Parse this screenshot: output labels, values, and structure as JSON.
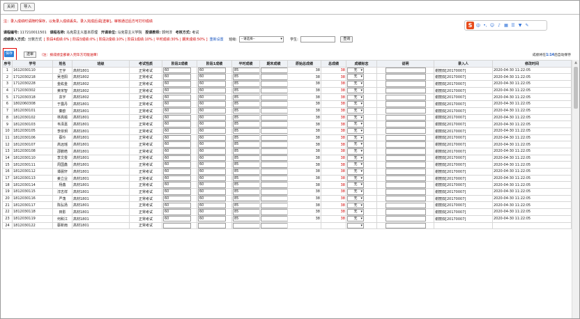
{
  "toolbar": {
    "close_label": "关闭",
    "import_label": "导入"
  },
  "notice": "注：录入成绩时请随时保存，以免录入成绩丢失。录入完成后请[送审]，审核通过后方可打印成绩",
  "course_info": {
    "code_label": "课程编号:",
    "code": "117210011501",
    "name_label": "课程名称:",
    "name": "马克思主义基本原理",
    "dept_label": "开课单位:",
    "dept": "马克思主义学院",
    "teacher_label": "授课教师:",
    "teacher": "郭何淳",
    "exam_label": "考核方式:",
    "exam": "考试"
  },
  "method": {
    "label": "成绩录入方式:",
    "mode": "分数方式",
    "weights": "[ 阶段4成绩:0% | 阶段3成绩:0% | 阶段2成绩:10% | 阶段1成绩:10% | 平时成绩:30% | 期末成绩:50% ]",
    "reset": "重新设置",
    "class_label": "班级:",
    "class_select": "--请选择--",
    "student_label": "学生:",
    "query_label": "查询"
  },
  "actions": {
    "save_label": "保存",
    "back_label": "送审",
    "hint": "（注：按成绩全部录入完毕方可能送审）",
    "autosave_pre": "成绩将在",
    "autosave_time": "1:14",
    "autosave_post": "后自动保存"
  },
  "table": {
    "headers": [
      "序号",
      "学号",
      "姓名",
      "班级",
      "考试性质",
      "阶段2成绩",
      "阶段1成绩",
      "平时成绩",
      "期末成绩",
      "原始总成绩",
      "总成绩",
      "成绩标志",
      "说明",
      "录入人",
      "修改时间"
    ],
    "rows": [
      {
        "no": "1",
        "id": "1612030110",
        "name": "王宇",
        "cls": "高材1801",
        "nature": "正常考试",
        "s2": "60",
        "s1": "60",
        "p": "85",
        "f": "",
        "raw": "38",
        "total": "38",
        "flag": "无",
        "recorder": "谢丽双[20170007]",
        "time": "2020-04-30 11:22:05"
      },
      {
        "no": "2",
        "id": "1712030218",
        "name": "吴浩阳",
        "cls": "高材1802",
        "nature": "正常考试",
        "s2": "60",
        "s1": "60",
        "p": "85",
        "f": "",
        "raw": "38",
        "total": "38",
        "flag": "无",
        "recorder": "谢丽双[20170007]",
        "time": "2020-04-30 11:22:05"
      },
      {
        "no": "3",
        "id": "1712030228",
        "name": "金紘金",
        "cls": "高材1802",
        "nature": "正常考试",
        "s2": "60",
        "s1": "60",
        "p": "85",
        "f": "",
        "raw": "38",
        "total": "38",
        "flag": "无",
        "recorder": "谢丽双[20170007]",
        "time": "2020-04-30 11:22:05"
      },
      {
        "no": "4",
        "id": "1712030302",
        "name": "黄宋智",
        "cls": "高材1802",
        "nature": "正常考试",
        "s2": "60",
        "s1": "60",
        "p": "85",
        "f": "",
        "raw": "38",
        "total": "38",
        "flag": "无",
        "recorder": "谢丽双[20170007]",
        "time": "2020-04-30 11:22:05"
      },
      {
        "no": "5",
        "id": "1712030318",
        "name": "袁宇",
        "cls": "高材1802",
        "nature": "正常考试",
        "s2": "60",
        "s1": "60",
        "p": "85",
        "f": "",
        "raw": "38",
        "total": "38",
        "flag": "无",
        "recorder": "谢丽双[20170007]",
        "time": "2020-04-30 11:22:05"
      },
      {
        "no": "6",
        "id": "1802060308",
        "name": "于露丹",
        "cls": "高材1801",
        "nature": "正常考试",
        "s2": "60",
        "s1": "60",
        "p": "85",
        "f": "",
        "raw": "38",
        "total": "38",
        "flag": "无",
        "recorder": "谢丽双[20170007]",
        "time": "2020-04-30 11:22:05"
      },
      {
        "no": "7",
        "id": "1812030101",
        "name": "秦欧",
        "cls": "高材1801",
        "nature": "正常考试",
        "s2": "60",
        "s1": "60",
        "p": "85",
        "f": "",
        "raw": "38",
        "total": "38",
        "flag": "无",
        "recorder": "谢丽双[20170007]",
        "time": "2020-04-30 11:22:05"
      },
      {
        "no": "8",
        "id": "1812030102",
        "name": "林高喻",
        "cls": "高材1801",
        "nature": "正常考试",
        "s2": "60",
        "s1": "60",
        "p": "85",
        "f": "",
        "raw": "38",
        "total": "38",
        "flag": "无",
        "recorder": "谢丽双[20170007]",
        "time": "2020-04-30 11:22:05"
      },
      {
        "no": "9",
        "id": "1812030103",
        "name": "韦泽嘉",
        "cls": "高材1801",
        "nature": "正常考试",
        "s2": "60",
        "s1": "60",
        "p": "85",
        "f": "",
        "raw": "38",
        "total": "38",
        "flag": "无",
        "recorder": "谢丽双[20170007]",
        "time": "2020-04-30 11:22:05"
      },
      {
        "no": "10",
        "id": "1812030105",
        "name": "李依玥",
        "cls": "高材1801",
        "nature": "正常考试",
        "s2": "60",
        "s1": "60",
        "p": "85",
        "f": "",
        "raw": "38",
        "total": "38",
        "flag": "无",
        "recorder": "谢丽双[20170007]",
        "time": "2020-04-30 11:22:05"
      },
      {
        "no": "11",
        "id": "1812030106",
        "name": "蔡玲",
        "cls": "高材1801",
        "nature": "正常考试",
        "s2": "60",
        "s1": "60",
        "p": "85",
        "f": "",
        "raw": "38",
        "total": "38",
        "flag": "无",
        "recorder": "谢丽双[20170007]",
        "time": "2020-04-30 11:22:05"
      },
      {
        "no": "12",
        "id": "1812030107",
        "name": "高远瑶",
        "cls": "高材1801",
        "nature": "正常考试",
        "s2": "60",
        "s1": "60",
        "p": "85",
        "f": "",
        "raw": "38",
        "total": "38",
        "flag": "无",
        "recorder": "谢丽双[20170007]",
        "time": "2020-04-30 11:22:05"
      },
      {
        "no": "13",
        "id": "1812030108",
        "name": "邵鹏皓",
        "cls": "高材1801",
        "nature": "正常考试",
        "s2": "60",
        "s1": "60",
        "p": "85",
        "f": "",
        "raw": "38",
        "total": "38",
        "flag": "无",
        "recorder": "谢丽双[20170007]",
        "time": "2020-04-30 11:22:05"
      },
      {
        "no": "14",
        "id": "1812030110",
        "name": "李文俊",
        "cls": "高材1801",
        "nature": "正常考试",
        "s2": "60",
        "s1": "60",
        "p": "85",
        "f": "",
        "raw": "38",
        "total": "38",
        "flag": "无",
        "recorder": "谢丽双[20170007]",
        "time": "2020-04-30 11:22:05"
      },
      {
        "no": "15",
        "id": "1812030111",
        "name": "周国鑫",
        "cls": "高材1801",
        "nature": "正常考试",
        "s2": "60",
        "s1": "60",
        "p": "85",
        "f": "",
        "raw": "38",
        "total": "38",
        "flag": "无",
        "recorder": "谢丽双[20170007]",
        "time": "2020-04-30 11:22:05"
      },
      {
        "no": "16",
        "id": "1812030112",
        "name": "谭晨轩",
        "cls": "高材1801",
        "nature": "正常考试",
        "s2": "60",
        "s1": "60",
        "p": "85",
        "f": "",
        "raw": "38",
        "total": "38",
        "flag": "无",
        "recorder": "谢丽双[20170007]",
        "time": "2020-04-30 11:22:05"
      },
      {
        "no": "17",
        "id": "1812030113",
        "name": "姜立业",
        "cls": "高材1801",
        "nature": "正常考试",
        "s2": "60",
        "s1": "60",
        "p": "85",
        "f": "",
        "raw": "38",
        "total": "38",
        "flag": "无",
        "recorder": "谢丽双[20170007]",
        "time": "2020-04-30 11:22:05"
      },
      {
        "no": "18",
        "id": "1812030114",
        "name": "杨鑫",
        "cls": "高材1801",
        "nature": "正常考试",
        "s2": "60",
        "s1": "60",
        "p": "85",
        "f": "",
        "raw": "38",
        "total": "38",
        "flag": "无",
        "recorder": "谢丽双[20170007]",
        "time": "2020-04-30 11:22:05"
      },
      {
        "no": "19",
        "id": "1812030115",
        "name": "淳志祥",
        "cls": "高材1801",
        "nature": "正常考试",
        "s2": "60",
        "s1": "60",
        "p": "85",
        "f": "",
        "raw": "38",
        "total": "38",
        "flag": "无",
        "recorder": "谢丽双[20170007]",
        "time": "2020-04-30 11:22:05"
      },
      {
        "no": "20",
        "id": "1812030116",
        "name": "严荡",
        "cls": "高材1801",
        "nature": "正常考试",
        "s2": "60",
        "s1": "60",
        "p": "85",
        "f": "",
        "raw": "38",
        "total": "38",
        "flag": "无",
        "recorder": "谢丽双[20170007]",
        "time": "2020-04-30 11:22:05"
      },
      {
        "no": "21",
        "id": "1812030117",
        "name": "陈弘扬",
        "cls": "高材1801",
        "nature": "正常考试",
        "s2": "60",
        "s1": "60",
        "p": "85",
        "f": "",
        "raw": "38",
        "total": "38",
        "flag": "无",
        "recorder": "谢丽双[20170007]",
        "time": "2020-04-30 11:22:05"
      },
      {
        "no": "22",
        "id": "1812030118",
        "name": "田影",
        "cls": "高材1801",
        "nature": "正常考试",
        "s2": "60",
        "s1": "60",
        "p": "85",
        "f": "",
        "raw": "38",
        "total": "38",
        "flag": "无",
        "recorder": "谢丽双[20170007]",
        "time": "2020-04-30 11:22:05"
      },
      {
        "no": "23",
        "id": "1812030119",
        "name": "何和江",
        "cls": "高材1801",
        "nature": "正常考试",
        "s2": "60",
        "s1": "60",
        "p": "85",
        "f": "",
        "raw": "38",
        "total": "38",
        "flag": "无",
        "recorder": "谢丽双[20170007]",
        "time": "2020-04-30 11:22:05"
      },
      {
        "no": "24",
        "id": "1812030122",
        "name": "蔡新雨",
        "cls": "高材1801",
        "nature": "正常考试",
        "s2": "",
        "s1": "",
        "p": "",
        "f": "",
        "raw": "",
        "total": "",
        "flag": "",
        "recorder": "",
        "time": ""
      }
    ]
  },
  "colors": {
    "accent": "#2f7fd8",
    "warning": "#d00000",
    "link": "#1a56c0"
  },
  "icons": {
    "ime": "sogou-ime-icon"
  }
}
